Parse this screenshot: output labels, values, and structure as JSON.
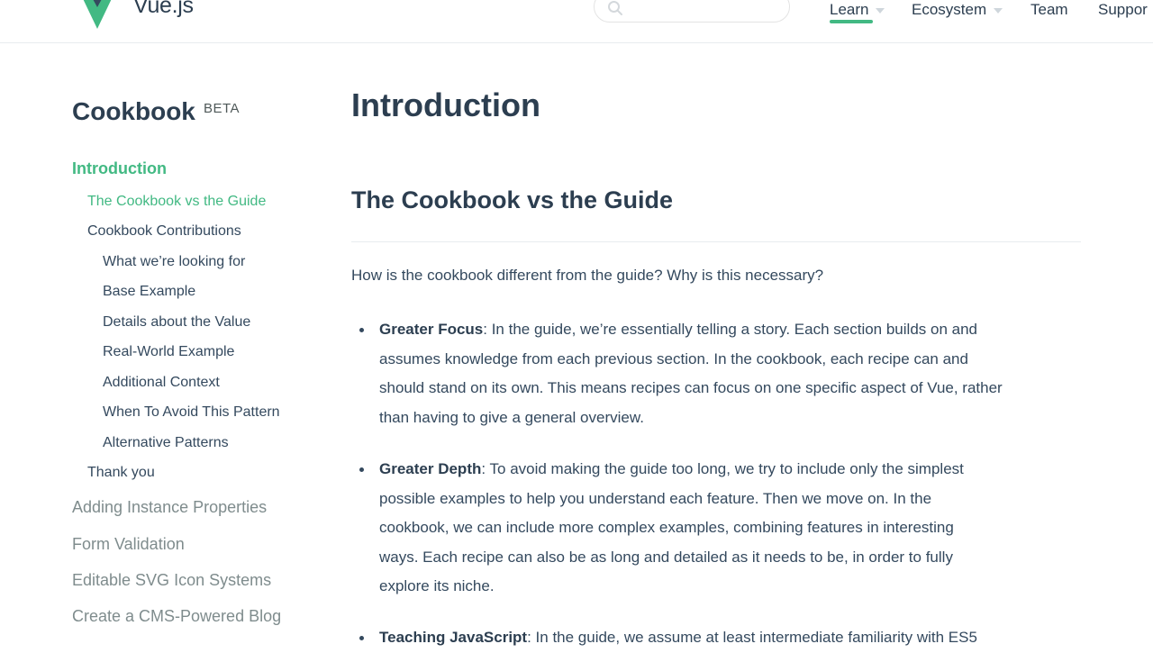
{
  "header": {
    "brand": "Vue.js",
    "search": {
      "placeholder": "",
      "value": ""
    },
    "nav": [
      {
        "label": "Learn",
        "has_dropdown": true,
        "active": true
      },
      {
        "label": "Ecosystem",
        "has_dropdown": true
      },
      {
        "label": "Team"
      },
      {
        "label": "Suppor"
      }
    ],
    "accent_color": "#42b983"
  },
  "sidebar": {
    "title": "Cookbook",
    "badge": "BETA",
    "items": [
      {
        "label": "Introduction",
        "level": 0,
        "active": true
      },
      {
        "label": "The Cookbook vs the Guide",
        "level": 1,
        "active": true
      },
      {
        "label": "Cookbook Contributions",
        "level": 1
      },
      {
        "label": "What we’re looking for",
        "level": 2
      },
      {
        "label": "Base Example",
        "level": 2
      },
      {
        "label": "Details about the Value",
        "level": 2
      },
      {
        "label": "Real-World Example",
        "level": 2
      },
      {
        "label": "Additional Context",
        "level": 2
      },
      {
        "label": "When To Avoid This Pattern",
        "level": 2
      },
      {
        "label": "Alternative Patterns",
        "level": 2
      },
      {
        "label": "Thank you",
        "level": 1
      },
      {
        "label": "Adding Instance Properties",
        "level": 0
      },
      {
        "label": "Form Validation",
        "level": 0
      },
      {
        "label": "Editable SVG Icon Systems",
        "level": 0
      },
      {
        "label": "Create a CMS-Powered Blog",
        "level": 0
      }
    ]
  },
  "main": {
    "title": "Introduction",
    "section_title": "The Cookbook vs the Guide",
    "lead": "How is the cookbook different from the guide? Why is this necessary?",
    "bullets": [
      {
        "term": "Greater Focus",
        "lines": [
          ": In the guide, we’re essentially telling a story. Each section builds on and",
          "assumes knowledge from each previous section. In the cookbook, each recipe can and",
          "should stand on its own. This means recipes can focus on one specific aspect of Vue, rather",
          "than having to give a general overview."
        ]
      },
      {
        "term": "Greater Depth",
        "lines": [
          ": To avoid making the guide too long, we try to include only the simplest",
          "possible examples to help you understand each feature. Then we move on. In the",
          "cookbook, we can include more complex examples, combining features in interesting",
          "ways. Each recipe can also be as long and detailed as it needs to be, in order to fully",
          "explore its niche."
        ]
      },
      {
        "term": "Teaching JavaScript",
        "lines": [
          ": In the guide, we assume at least intermediate familiarity with ES5"
        ]
      }
    ]
  }
}
